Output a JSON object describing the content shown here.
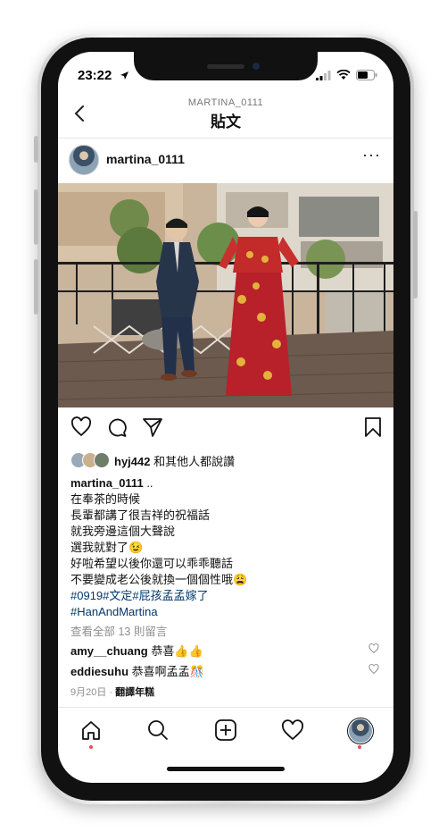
{
  "status": {
    "time": "23:22"
  },
  "header": {
    "subtitle": "MARTINA_0111",
    "title": "貼文"
  },
  "post": {
    "username": "martina_0111",
    "more_label": "···",
    "likes": {
      "user": "hyj442",
      "suffix": "和其他人都說讚"
    },
    "caption": {
      "user": "martina_0111",
      "first": "..",
      "lines": [
        "在奉茶的時候",
        "長輩都講了很吉祥的祝福話",
        "就我旁邊這個大聲說",
        "選我就對了😉",
        "好啦希望以後你還可以乖乖聽話",
        "不要變成老公後就換一個個性哦😩"
      ],
      "hashtags_1": "#0919#文定#屁孩孟孟嫁了",
      "hashtags_2": "#HanAndMartina"
    },
    "view_all": "查看全部 13 則留言",
    "comments": [
      {
        "user": "amy__chuang",
        "text": "恭喜👍👍"
      },
      {
        "user": "eddiesuhu",
        "text": "恭喜啊孟孟🎊"
      }
    ],
    "date": "9月20日",
    "translate": "翻譯年糕"
  },
  "icons": [
    "heart-icon",
    "comment-icon",
    "share-icon",
    "bookmark-icon",
    "home-icon",
    "search-icon",
    "new-post-icon",
    "activity-icon",
    "profile-icon"
  ]
}
